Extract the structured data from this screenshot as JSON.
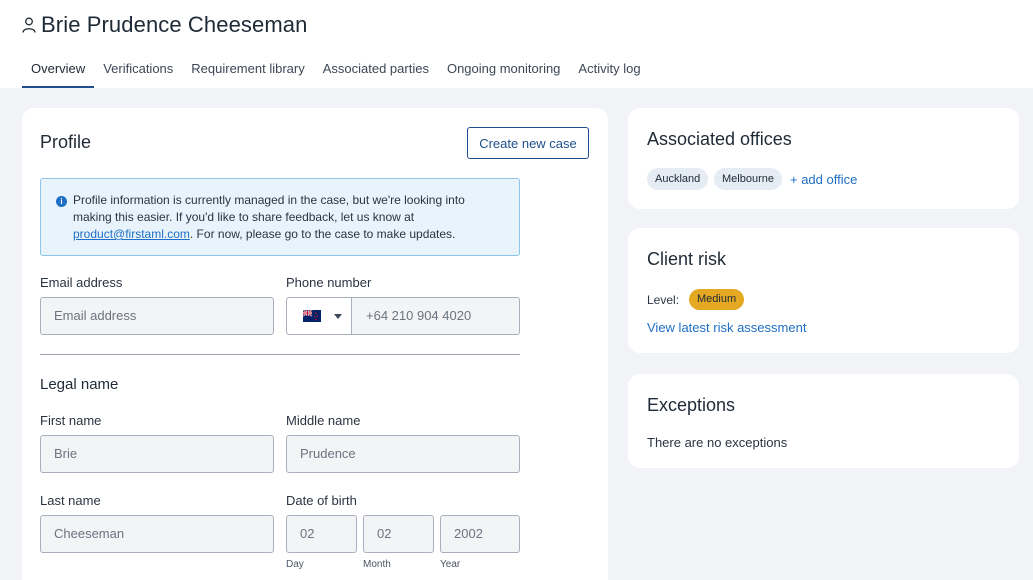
{
  "header": {
    "person_icon": "person-icon",
    "title": "Brie Prudence Cheeseman"
  },
  "tabs": [
    {
      "label": "Overview",
      "active": true
    },
    {
      "label": "Verifications",
      "active": false
    },
    {
      "label": "Requirement library",
      "active": false
    },
    {
      "label": "Associated parties",
      "active": false
    },
    {
      "label": "Ongoing monitoring",
      "active": false
    },
    {
      "label": "Activity log",
      "active": false
    }
  ],
  "profile": {
    "title": "Profile",
    "create_case_label": "Create new case",
    "info": {
      "icon": "info-icon",
      "text_before": "Profile information is currently managed in the case, but we're looking into making this easier. If you'd like to share feedback, let us know at ",
      "email_link": "product@firstaml.com",
      "text_after": ". For now, please go to the case to make updates."
    },
    "email": {
      "label": "Email address",
      "placeholder": "Email address"
    },
    "phone": {
      "label": "Phone number",
      "country_flag": "nz-flag-icon",
      "value": "+64 210 904 4020"
    },
    "legal_name": {
      "title": "Legal name",
      "first_name": {
        "label": "First name",
        "value": "Brie"
      },
      "middle_name": {
        "label": "Middle name",
        "value": "Prudence"
      },
      "last_name": {
        "label": "Last name",
        "value": "Cheeseman"
      }
    },
    "dob": {
      "label": "Date of birth",
      "day": {
        "value": "02",
        "sublabel": "Day"
      },
      "month": {
        "value": "02",
        "sublabel": "Month"
      },
      "year": {
        "value": "2002",
        "sublabel": "Year"
      }
    }
  },
  "offices": {
    "title": "Associated offices",
    "items": [
      "Auckland",
      "Melbourne"
    ],
    "add_label": "+ add office"
  },
  "risk": {
    "title": "Client risk",
    "level_label": "Level:",
    "level_value": "Medium",
    "level_color": "#e5a823",
    "link_label": "View latest risk assessment"
  },
  "exceptions": {
    "title": "Exceptions",
    "empty_text": "There are no exceptions"
  },
  "colors": {
    "accent": "#1f4e8c",
    "link": "#1f6fc5",
    "info_bg": "#e8f3fc",
    "page_bg": "#f1f3f6"
  }
}
